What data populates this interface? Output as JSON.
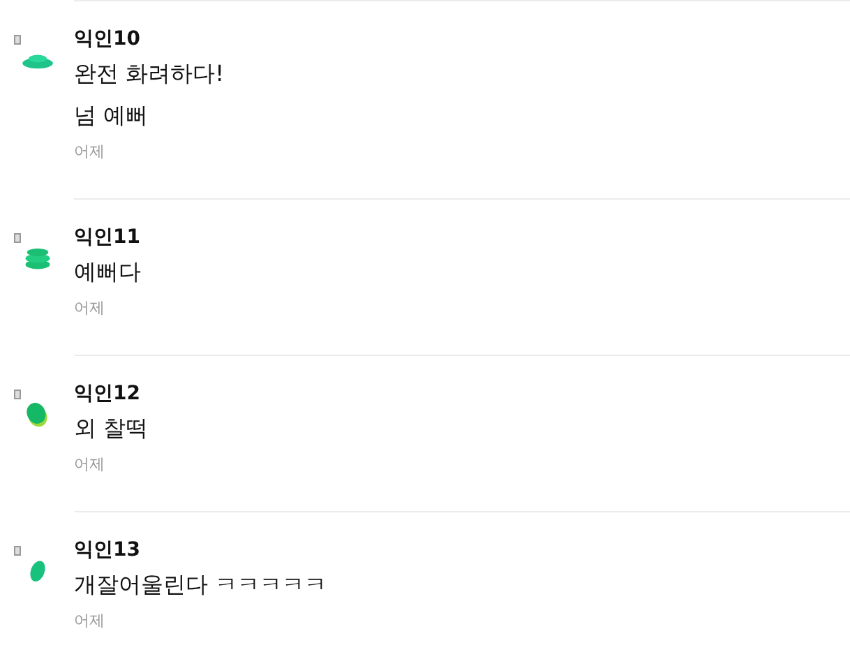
{
  "comments": [
    {
      "author": "익인10",
      "avatar": {
        "kind": "disc"
      },
      "lines": [
        "완전 화려하다!",
        "넘 예뻐"
      ],
      "time": "어제"
    },
    {
      "author": "익인11",
      "avatar": {
        "kind": "stack"
      },
      "lines": [
        "예뻐다"
      ],
      "time": "어제"
    },
    {
      "author": "익인12",
      "avatar": {
        "kind": "egg"
      },
      "lines": [
        "외 찰떡"
      ],
      "time": "어제"
    },
    {
      "author": "익인13",
      "avatar": {
        "kind": "leaf"
      },
      "lines": [
        "개잘어울린다 ㅋㅋㅋㅋㅋ"
      ],
      "time": "어제"
    }
  ]
}
